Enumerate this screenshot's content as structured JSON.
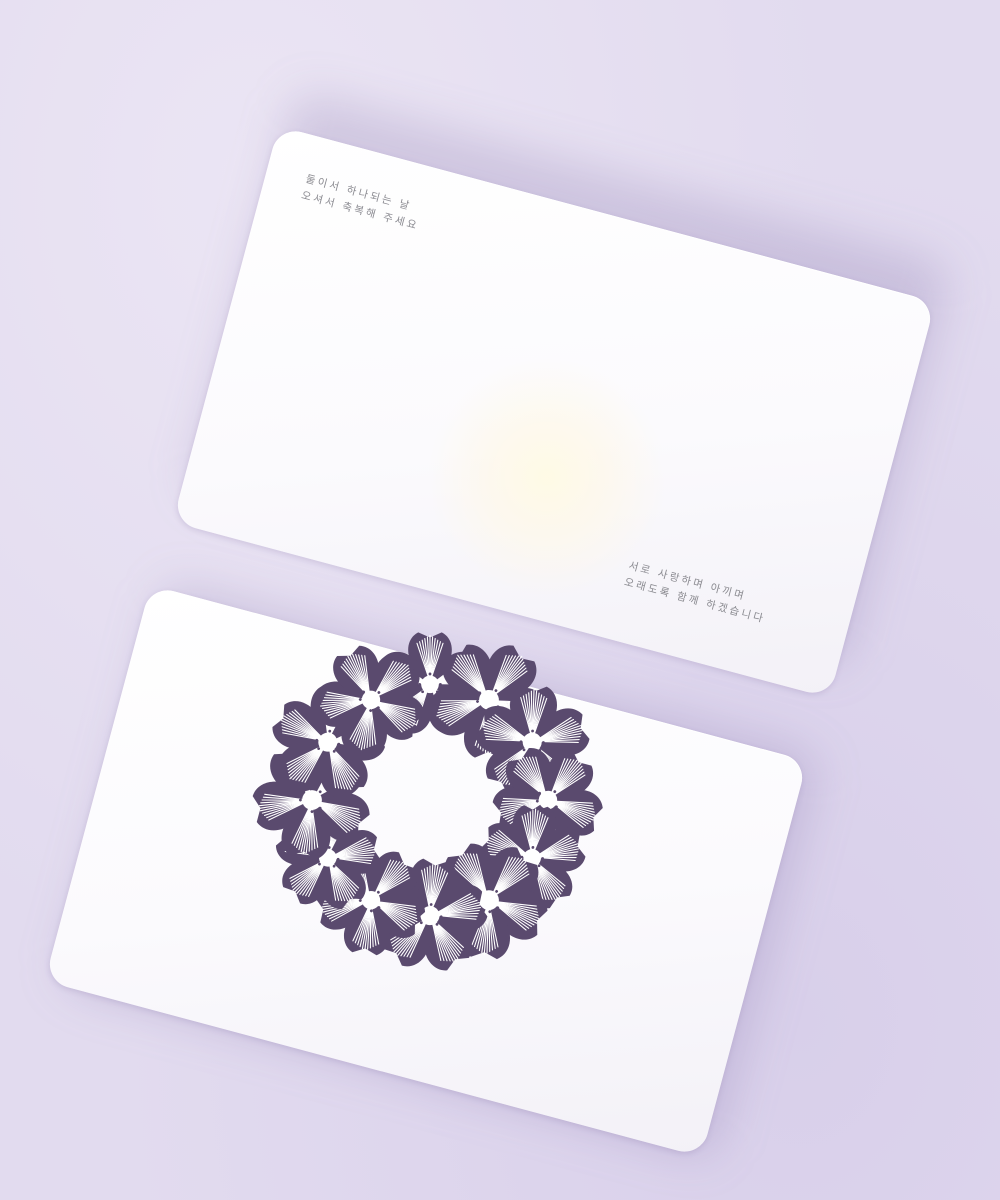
{
  "scene": {
    "background_color": "#e2dbef",
    "card_color": "#ffffff",
    "ink_color": "#8a8a90",
    "wreath_color": "#5a4a6e"
  },
  "top_card": {
    "verse_top": [
      "둘이서 하나되는 날",
      "오셔서 축복해 주세요"
    ],
    "verse_bottom": [
      "서로 사랑하며 아끼며",
      "오래도록 함께 하겠습니다"
    ]
  },
  "bottom_card": {
    "illustration": "flower-wreath"
  }
}
